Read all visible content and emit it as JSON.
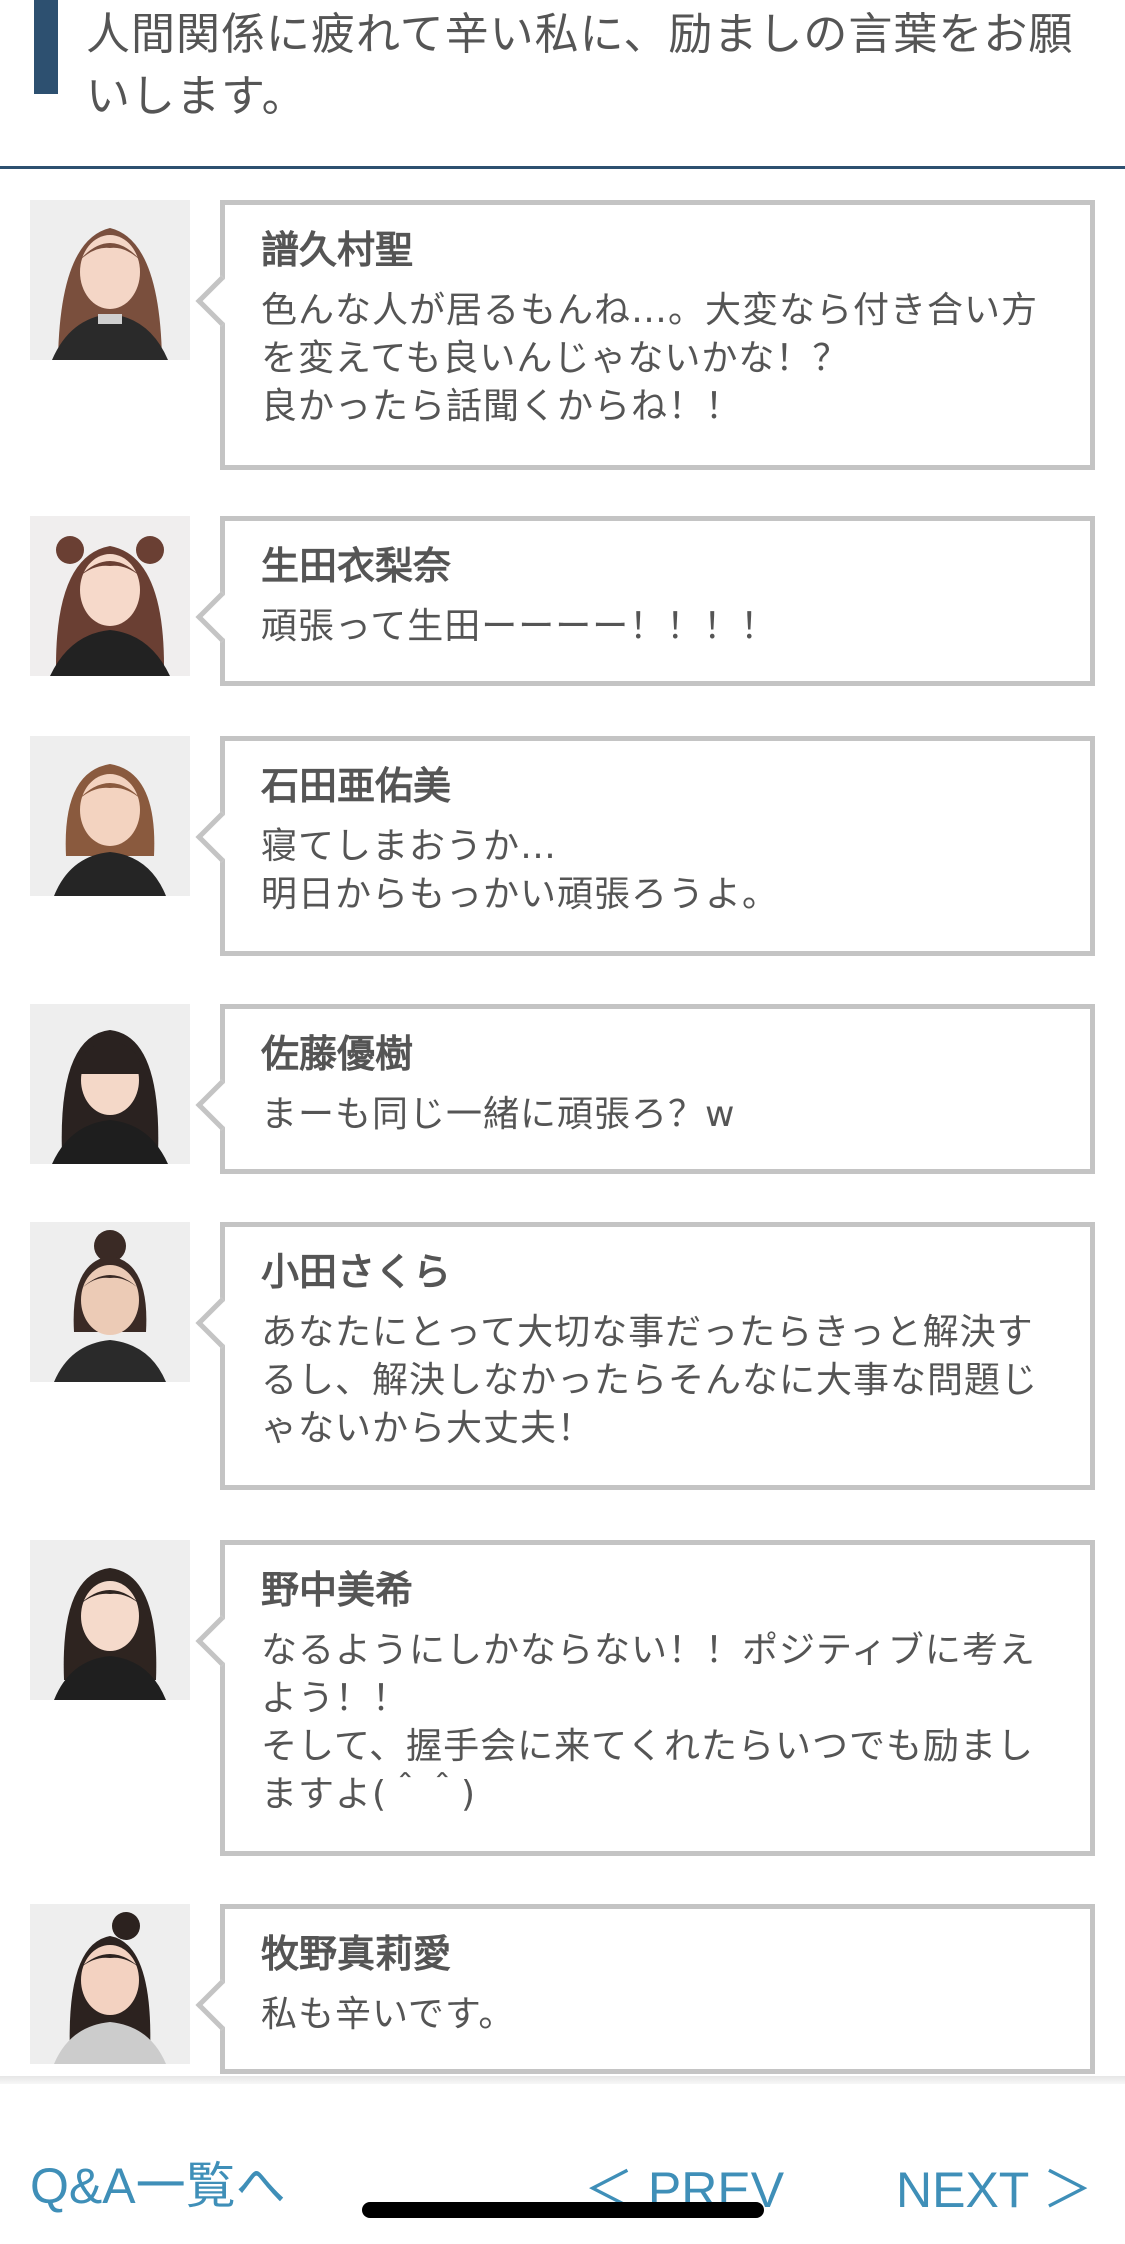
{
  "header": {
    "title": "人間関係に疲れて辛い私に、励ましの言葉をお願いします。"
  },
  "answers": [
    {
      "name": "譜久村聖",
      "text": "色んな人が居るもんね…。大変なら付き合い方を変えても良いんじゃないかな！？\n良かったら話聞くからね！！"
    },
    {
      "name": "生田衣梨奈",
      "text": "頑張って生田ーーーー！！！！"
    },
    {
      "name": "石田亜佑美",
      "text": "寝てしまおうか…\n明日からもっかい頑張ろうよ。"
    },
    {
      "name": "佐藤優樹",
      "text": "まーも同じ一緒に頑張ろ？w"
    },
    {
      "name": "小田さくら",
      "text": "あなたにとって大切な事だったらきっと解決するし、解決しなかったらそんなに大事な問題じゃないから大丈夫！"
    },
    {
      "name": "野中美希",
      "text": "なるようにしかならない！！ポジティブに考えよう！！\nそして、握手会に来てくれたらいつでも励ましますよ(＾＾)"
    },
    {
      "name": "牧野真莉愛",
      "text": "私も辛いです。"
    }
  ],
  "footer": {
    "list_link": "Q&A一覧へ",
    "prev_link": "＜ PREV",
    "next_link": "NEXT ＞"
  },
  "colors": {
    "accent": "#2d5070",
    "link": "#3f8fb8",
    "bubble_border": "#c4c4c4",
    "text": "#555555"
  }
}
